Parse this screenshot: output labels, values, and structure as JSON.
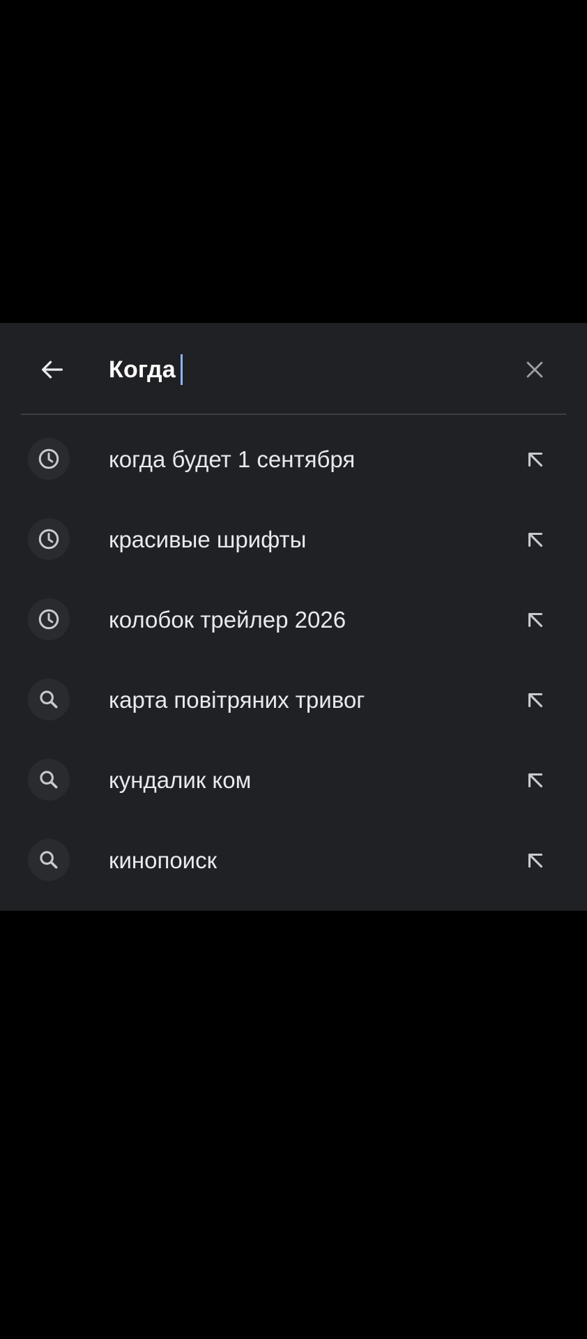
{
  "search": {
    "query": "Когда",
    "back_icon": "arrow-left-icon",
    "clear_icon": "close-icon"
  },
  "suggestions": [
    {
      "label": "когда будет 1 сентября",
      "icon": "history-clock-icon"
    },
    {
      "label": "красивые шрифты",
      "icon": "history-clock-icon"
    },
    {
      "label": "колобок трейлер 2026",
      "icon": "history-clock-icon"
    },
    {
      "label": "карта повітряних тривог",
      "icon": "search-icon"
    },
    {
      "label": "кундалик ком",
      "icon": "search-icon"
    },
    {
      "label": "кинопоиск",
      "icon": "search-icon"
    }
  ],
  "colors": {
    "background": "#000000",
    "panel": "#202124",
    "text": "#e8eaed",
    "icon": "#c8cacd",
    "caret": "#8ab4f8",
    "divider": "#3c4043"
  }
}
